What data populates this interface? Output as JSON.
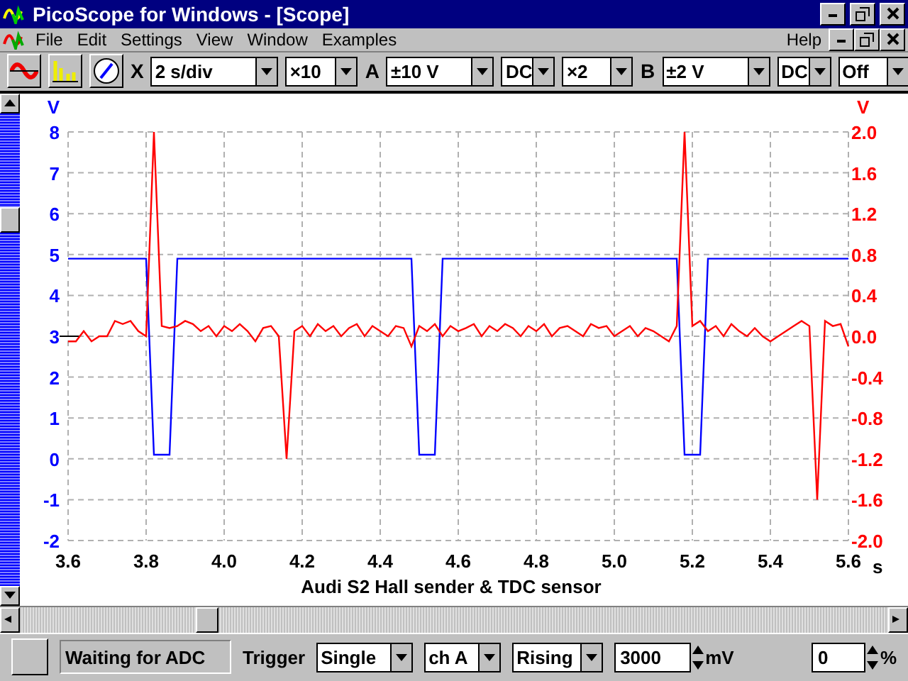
{
  "window": {
    "title": "PicoScope for Windows - [Scope]"
  },
  "menu": {
    "items": [
      "File",
      "Edit",
      "Settings",
      "View",
      "Window",
      "Examples"
    ],
    "help": "Help"
  },
  "toolbar": {
    "controls": [
      {
        "kind": "label",
        "text": "X"
      },
      {
        "kind": "combo",
        "value": "2 s/div"
      },
      {
        "kind": "combo",
        "value": "×10"
      },
      {
        "kind": "label",
        "text": "A"
      },
      {
        "kind": "combo",
        "value": "±10 V"
      },
      {
        "kind": "combo",
        "value": "DC"
      },
      {
        "kind": "combo",
        "value": "×2"
      },
      {
        "kind": "label",
        "text": "B"
      },
      {
        "kind": "combo",
        "value": "±2 V"
      },
      {
        "kind": "combo",
        "value": "DC"
      },
      {
        "kind": "combo",
        "value": "Off"
      }
    ]
  },
  "scope": {
    "chart_data": {
      "type": "line",
      "grid": true,
      "title": "Audi S2 Hall sender & TDC sensor",
      "xlabel": "s",
      "ylabel": "V",
      "y2label": "V",
      "xlim": [
        3.6,
        5.6
      ],
      "ylim": [
        -2,
        8
      ],
      "y2lim": [
        -2,
        2
      ],
      "xticks": [
        {
          "value": 3.6,
          "label": "3.6"
        },
        {
          "value": 3.8,
          "label": "3.8"
        },
        {
          "value": 4,
          "label": "4.0"
        },
        {
          "value": 4.2,
          "label": "4.2"
        },
        {
          "value": 4.4,
          "label": "4.4"
        },
        {
          "value": 4.6,
          "label": "4.6"
        },
        {
          "value": 4.8,
          "label": "4.8"
        },
        {
          "value": 5,
          "label": "5.0"
        },
        {
          "value": 5.2,
          "label": "5.2"
        },
        {
          "value": 5.4,
          "label": "5.4"
        },
        {
          "value": 5.6,
          "label": "5.6"
        }
      ],
      "yticks": [
        8,
        7,
        6,
        5,
        4,
        3,
        2,
        1,
        0,
        -1,
        -2
      ],
      "y2ticks": [
        {
          "value": 2,
          "label": "2.0"
        },
        {
          "value": 1.6,
          "label": "1.6"
        },
        {
          "value": 1.2,
          "label": "1.2"
        },
        {
          "value": 0.8,
          "label": "0.8"
        },
        {
          "value": 0.4,
          "label": "0.4"
        },
        {
          "value": 0,
          "label": "0.0"
        },
        {
          "value": -0.4,
          "label": "-0.4"
        },
        {
          "value": -0.8,
          "label": "-0.8"
        },
        {
          "value": -1.2,
          "label": "-1.2"
        },
        {
          "value": -1.6,
          "label": "-1.6"
        },
        {
          "value": -2,
          "label": "-2.0"
        }
      ],
      "x": [
        3.6,
        3.62,
        3.64,
        3.66,
        3.68,
        3.7,
        3.72,
        3.74,
        3.76,
        3.78,
        3.8,
        3.82,
        3.84,
        3.86,
        3.88,
        3.9,
        3.92,
        3.94,
        3.96,
        3.98,
        4,
        4.02,
        4.04,
        4.06,
        4.08,
        4.1,
        4.12,
        4.14,
        4.16,
        4.18,
        4.2,
        4.22,
        4.24,
        4.26,
        4.28,
        4.3,
        4.32,
        4.34,
        4.36,
        4.38,
        4.4,
        4.42,
        4.44,
        4.46,
        4.48,
        4.5,
        4.52,
        4.54,
        4.56,
        4.58,
        4.6,
        4.62,
        4.64,
        4.66,
        4.68,
        4.7,
        4.72,
        4.74,
        4.76,
        4.78,
        4.8,
        4.82,
        4.84,
        4.86,
        4.88,
        4.9,
        4.92,
        4.94,
        4.96,
        4.98,
        5,
        5.02,
        5.04,
        5.06,
        5.08,
        5.1,
        5.12,
        5.14,
        5.16,
        5.18,
        5.2,
        5.22,
        5.24,
        5.26,
        5.28,
        5.3,
        5.32,
        5.34,
        5.36,
        5.38,
        5.4,
        5.42,
        5.44,
        5.46,
        5.48,
        5.5,
        5.52,
        5.54,
        5.56,
        5.58,
        5.6
      ],
      "series": [
        {
          "color": "#0000ff",
          "values": [
            4.9,
            4.9,
            4.9,
            4.9,
            4.9,
            4.9,
            4.9,
            4.9,
            4.9,
            4.9,
            4.9,
            0.1,
            0.1,
            0.1,
            4.9,
            4.9,
            4.9,
            4.9,
            4.9,
            4.9,
            4.9,
            4.9,
            4.9,
            4.9,
            4.9,
            4.9,
            4.9,
            4.9,
            4.9,
            4.9,
            4.9,
            4.9,
            4.9,
            4.9,
            4.9,
            4.9,
            4.9,
            4.9,
            4.9,
            4.9,
            4.9,
            4.9,
            4.9,
            4.9,
            4.9,
            0.1,
            0.1,
            0.1,
            4.9,
            4.9,
            4.9,
            4.9,
            4.9,
            4.9,
            4.9,
            4.9,
            4.9,
            4.9,
            4.9,
            4.9,
            4.9,
            4.9,
            4.9,
            4.9,
            4.9,
            4.9,
            4.9,
            4.9,
            4.9,
            4.9,
            4.9,
            4.9,
            4.9,
            4.9,
            4.9,
            4.9,
            4.9,
            4.9,
            4.9,
            0.1,
            0.1,
            0.1,
            4.9,
            4.9,
            4.9,
            4.9,
            4.9,
            4.9,
            4.9,
            4.9,
            4.9,
            4.9,
            4.9,
            4.9,
            4.9,
            4.9,
            4.9,
            4.9,
            4.9,
            4.9,
            4.9
          ]
        },
        {
          "color": "#ff0000",
          "axis": "y2",
          "values": [
            -0.05,
            -0.05,
            0.05,
            -0.05,
            0,
            0,
            0.15,
            0.12,
            0.15,
            0.05,
            0,
            2,
            0.1,
            0.08,
            0.1,
            0.15,
            0.12,
            0.05,
            0.1,
            0,
            0.1,
            0.05,
            0.12,
            0.05,
            -0.05,
            0.08,
            0.1,
            0,
            -1.2,
            0.05,
            0.1,
            0,
            0.12,
            0.05,
            0.1,
            0,
            0.08,
            0.12,
            0,
            0.1,
            0.05,
            0,
            0.1,
            0.08,
            -0.1,
            0.1,
            0.05,
            0.12,
            0,
            0.1,
            0.05,
            0.08,
            0.12,
            0,
            0.1,
            0.05,
            0.12,
            0.08,
            0,
            0.1,
            0.05,
            0.12,
            0,
            0.08,
            0.1,
            0.05,
            0,
            0.12,
            0.08,
            0.1,
            0,
            0.05,
            0.1,
            0,
            0.08,
            0.05,
            0,
            -0.05,
            0.1,
            2,
            0.1,
            0.15,
            0.05,
            0.1,
            0,
            0.12,
            0.05,
            0,
            0.08,
            0,
            -0.05,
            0,
            0.05,
            0.1,
            0.15,
            0.1,
            -1.6,
            0.15,
            0.1,
            0.12,
            -0.1
          ]
        }
      ]
    }
  },
  "status": {
    "text": "Waiting for ADC",
    "trigger_label": "Trigger",
    "mode": "Single",
    "channel": "ch A",
    "edge": "Rising",
    "level": "3000",
    "level_unit": "mV",
    "delay": "0",
    "delay_unit": "%"
  }
}
